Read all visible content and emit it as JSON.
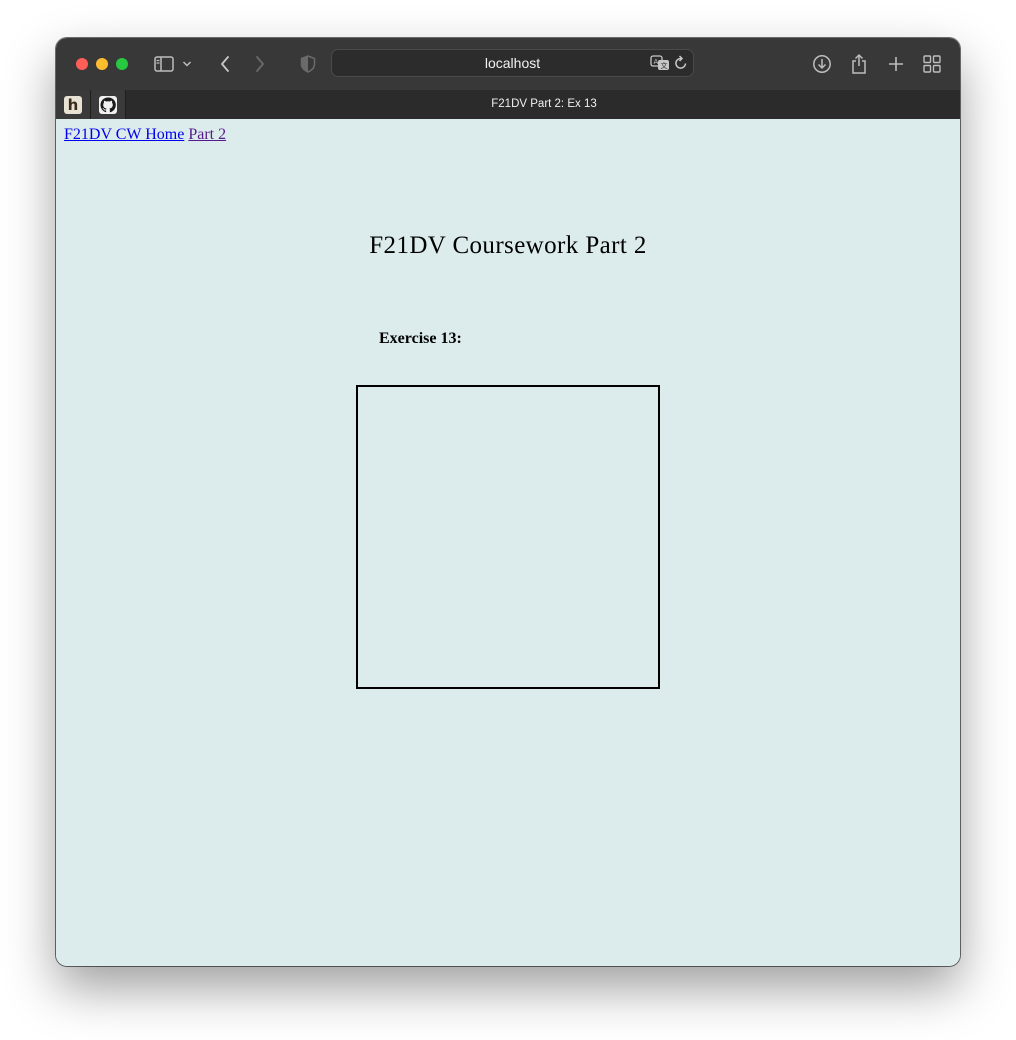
{
  "browser": {
    "address": "localhost",
    "tab_title": "F21DV Part 2: Ex 13",
    "toolbar_icons": [
      "sidebar-icon",
      "chevron-down-icon",
      "back-icon",
      "forward-icon",
      "shield-icon",
      "translate-icon",
      "reload-icon",
      "download-icon",
      "share-icon",
      "new-tab-icon",
      "tab-overview-icon"
    ],
    "pinned_tabs": [
      {
        "icon": "h-favicon",
        "letter": "h"
      },
      {
        "icon": "github-icon"
      }
    ]
  },
  "page": {
    "nav_links": [
      {
        "label": "F21DV CW Home"
      },
      {
        "label": "Part 2"
      }
    ],
    "heading": "F21DV Coursework Part 2",
    "exercise_label": "Exercise 13:"
  },
  "colors": {
    "page_background": "#dcecec",
    "link": "#0000ee",
    "visited_link": "#551a8b",
    "toolbar": "#383838"
  }
}
